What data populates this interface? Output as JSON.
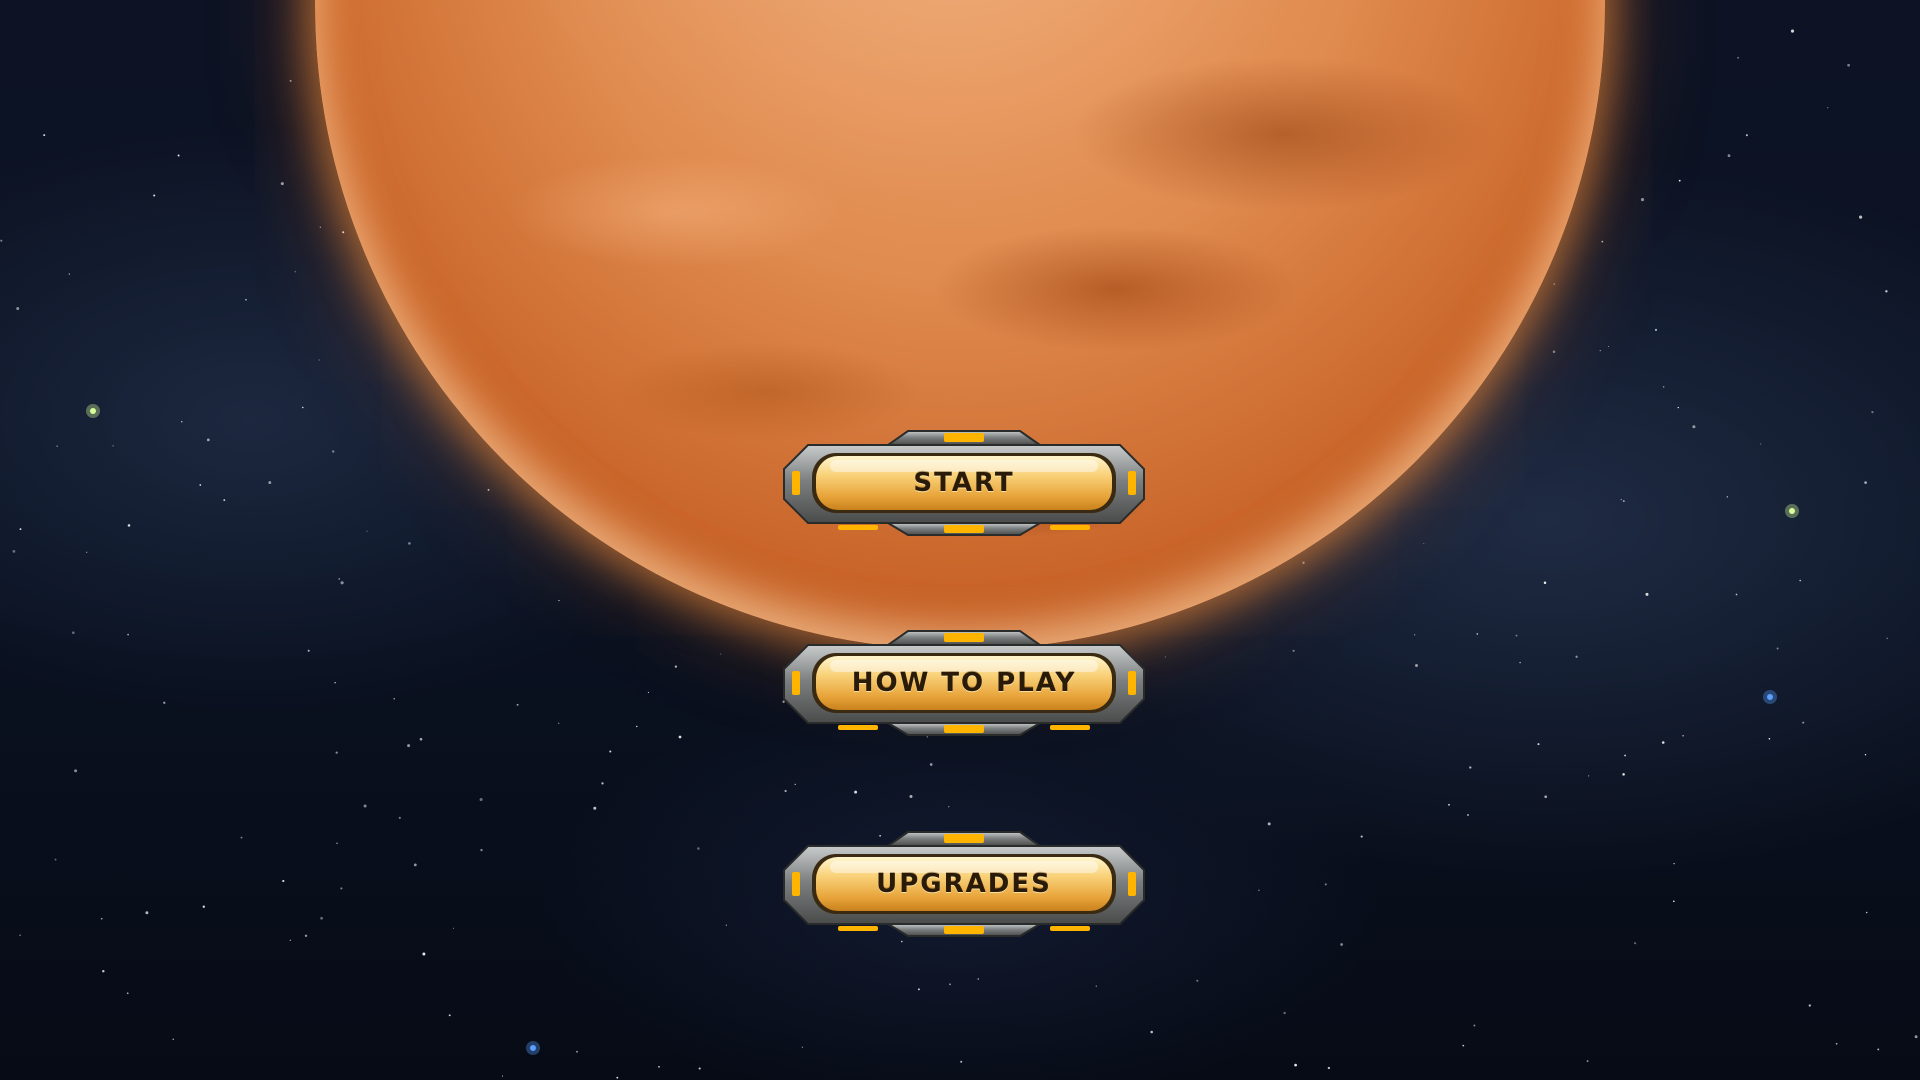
{
  "main_menu": {
    "buttons": [
      {
        "id": "start",
        "label": "START"
      },
      {
        "id": "how_to_play",
        "label": "HOW TO PLAY"
      },
      {
        "id": "upgrades",
        "label": "UPGRADES"
      }
    ]
  },
  "colors": {
    "planet": "#e08b4f",
    "button_gold": "#f6c25a",
    "button_frame": "#8d8f8f",
    "button_accent": "#ffb400",
    "space": "#0a1222"
  }
}
